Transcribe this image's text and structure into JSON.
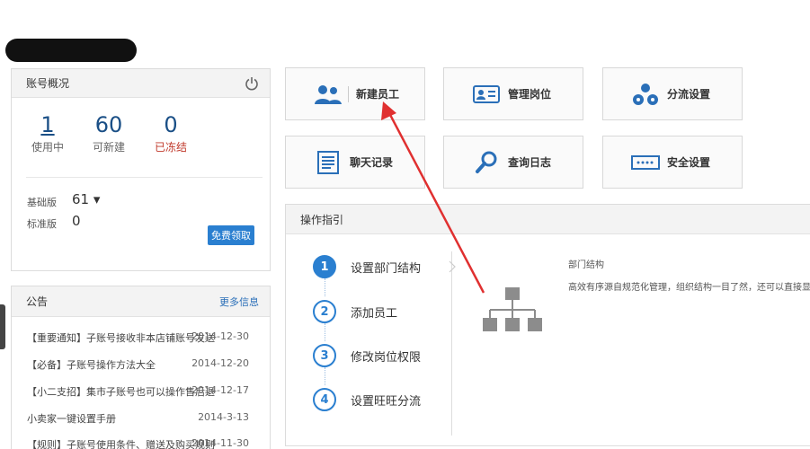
{
  "account": {
    "title": "账号概况",
    "stats": [
      {
        "value": "1",
        "label": "使用中"
      },
      {
        "value": "60",
        "label": "可新建"
      },
      {
        "value": "0",
        "label": "已冻结"
      }
    ],
    "editions": [
      {
        "name": "基础版",
        "value": "61 ▾"
      },
      {
        "name": "标准版",
        "value": "0"
      }
    ],
    "free_button": "免费领取"
  },
  "notice": {
    "title": "公告",
    "more": "更多信息",
    "items": [
      {
        "text": "【重要通知】子账号接收非本店铺账号发送",
        "date": "2014-12-30"
      },
      {
        "text": "【必备】子账号操作方法大全",
        "date": "2014-12-20"
      },
      {
        "text": "【小二支招】集市子账号也可以操作售后退",
        "date": "2014-12-17"
      },
      {
        "text": "小卖家一键设置手册",
        "date": "2014-3-13"
      },
      {
        "text": "【规则】子账号使用条件、赠送及购买规则",
        "date": "2014-11-30"
      }
    ]
  },
  "tiles": [
    {
      "label": "新建员工",
      "icon": "users-icon"
    },
    {
      "label": "管理岗位",
      "icon": "id-card-icon"
    },
    {
      "label": "分流设置",
      "icon": "split-flow-icon"
    },
    {
      "label": "聊天记录",
      "icon": "document-icon"
    },
    {
      "label": "查询日志",
      "icon": "search-icon"
    },
    {
      "label": "安全设置",
      "icon": "password-icon"
    }
  ],
  "guide": {
    "title": "操作指引",
    "steps": [
      {
        "num": "1",
        "label": "设置部门结构"
      },
      {
        "num": "2",
        "label": "添加员工"
      },
      {
        "num": "3",
        "label": "修改岗位权限"
      },
      {
        "num": "4",
        "label": "设置旺旺分流"
      }
    ],
    "desc_title": "部门结构",
    "desc_text": "高效有序源自规范化管理，组织结构一目了然，还可以直接显示"
  },
  "colors": {
    "accent": "#2a7fd0",
    "stat_blue": "#1a4f86",
    "frozen_red": "#c0392b",
    "arrow_red": "#e03030"
  }
}
